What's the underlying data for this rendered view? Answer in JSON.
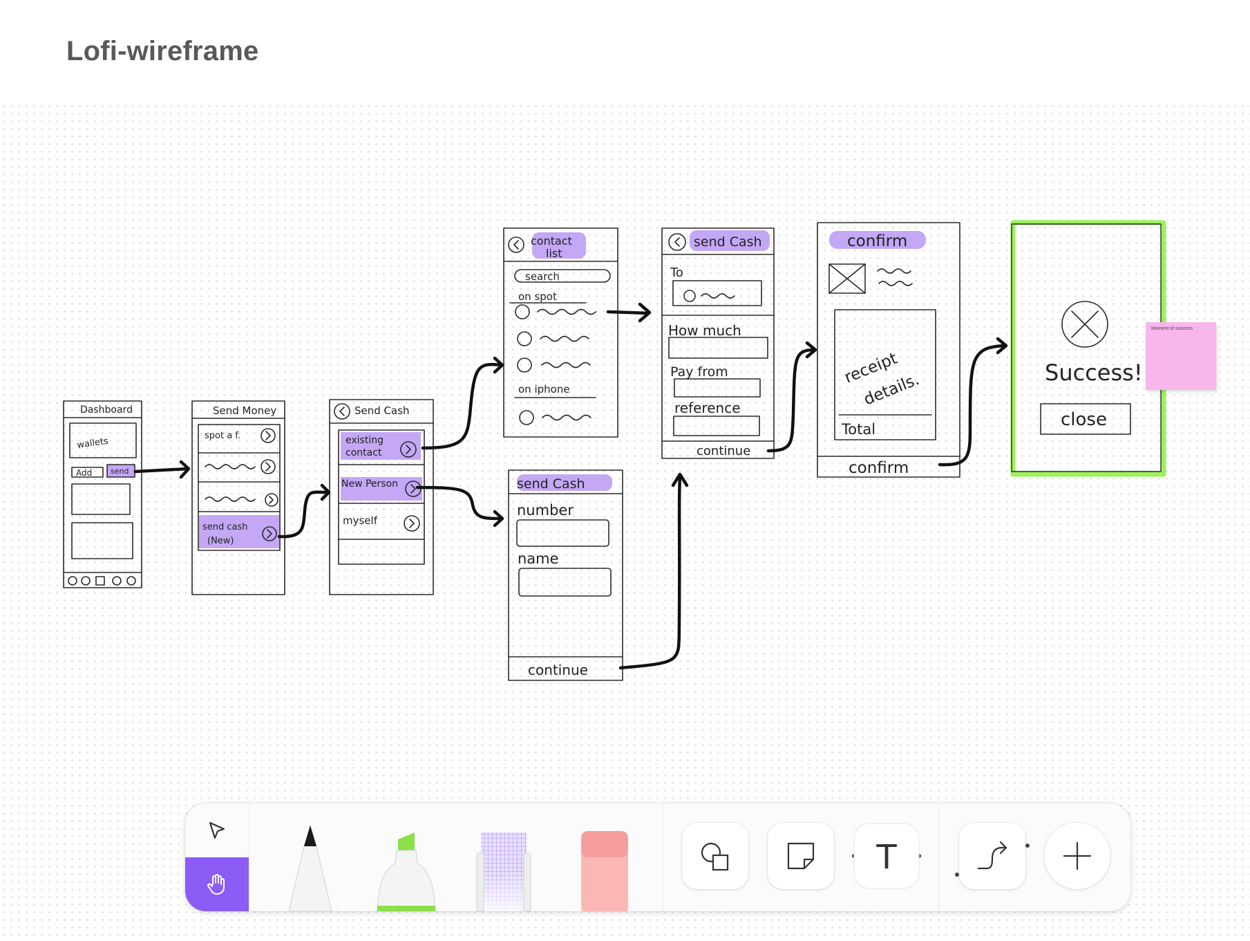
{
  "board_title": "Lofi-wireframe",
  "frames": {
    "dashboard": {
      "title": "Dashboard",
      "wallets": "wallets",
      "add": "Add",
      "send": "send"
    },
    "send_money": {
      "title": "Send Money",
      "spot": "spot a f.",
      "send_cash": "send cash",
      "new_tag": "(New)"
    },
    "send_cash": {
      "title": "Send Cash",
      "existing_1": "existing",
      "existing_2": "contact",
      "new_person": "New Person",
      "myself": "myself"
    },
    "contact_list": {
      "title_1": "contact",
      "title_2": "list",
      "search": "search",
      "on_spot": "on spot",
      "on_iphone": "on iphone"
    },
    "send_cash_new": {
      "title": "send Cash",
      "number": "number",
      "name": "name",
      "continue": "continue"
    },
    "send_cash_amount": {
      "title": "send Cash",
      "to": "To",
      "how_much": "How much",
      "pay_from": "Pay from",
      "reference": "reference",
      "continue": "continue"
    },
    "confirm": {
      "title": "confirm",
      "receipt_1": "receipt",
      "receipt_2": "details.",
      "total": "Total",
      "confirm_button": "confirm"
    },
    "success": {
      "message": "Success!",
      "close": "close"
    }
  },
  "sticky_note": {
    "text": "Moment of success"
  },
  "colors": {
    "highlight": "#c4a7f5",
    "success_frame": "#9cf25a",
    "sticky": "#f7b7ea",
    "active_tool": "#8b5cf6",
    "ink": "#1b1b1b"
  },
  "toolbar": {
    "tools": [
      {
        "name": "select",
        "icon": "pointer-arrow-icon",
        "active": false
      },
      {
        "name": "hand",
        "icon": "hand-icon",
        "active": true
      },
      {
        "name": "pen",
        "icon": "pen-icon"
      },
      {
        "name": "highlighter",
        "icon": "highlighter-icon",
        "color": "#8be04a"
      },
      {
        "name": "lasso",
        "icon": "lasso-grid-icon"
      },
      {
        "name": "eraser",
        "icon": "eraser-icon",
        "color": "#f7a3a3"
      },
      {
        "name": "shapes",
        "icon": "shapes-icon"
      },
      {
        "name": "sticky",
        "icon": "sticky-note-icon"
      },
      {
        "name": "text",
        "icon": "text-icon",
        "label": "T"
      },
      {
        "name": "connector",
        "icon": "connector-icon"
      },
      {
        "name": "add",
        "icon": "plus-icon"
      }
    ]
  }
}
